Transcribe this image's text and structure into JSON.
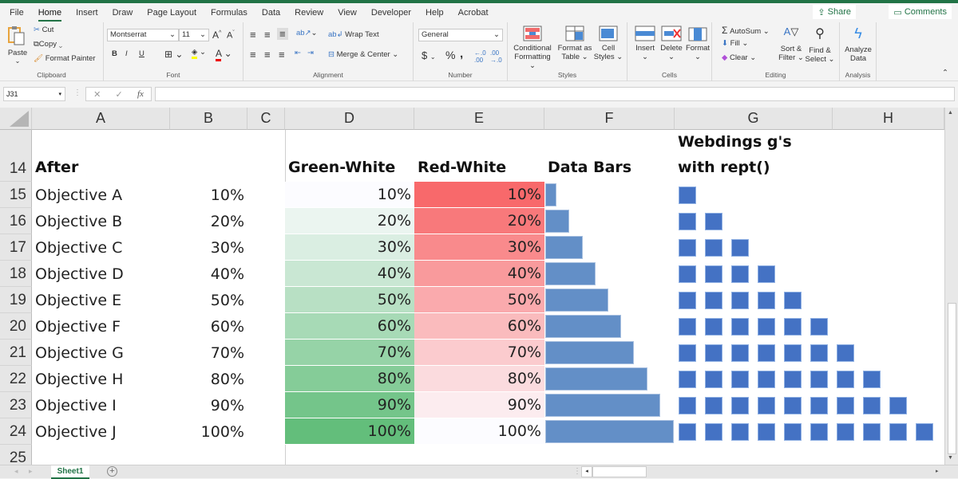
{
  "menu": {
    "items": [
      "File",
      "Home",
      "Insert",
      "Draw",
      "Page Layout",
      "Formulas",
      "Data",
      "Review",
      "View",
      "Developer",
      "Help",
      "Acrobat"
    ],
    "active": "Home",
    "share_label": "Share",
    "comments_label": "Comments"
  },
  "ribbon": {
    "clipboard": {
      "label": "Clipboard",
      "paste": "Paste",
      "cut": "Cut",
      "copy": "Copy",
      "format_painter": "Format Painter"
    },
    "font": {
      "label": "Font",
      "font_name": "Montserrat",
      "font_size": "11",
      "bold": "B",
      "italic": "I",
      "underline": "U"
    },
    "alignment": {
      "label": "Alignment",
      "wrap_text": "Wrap Text",
      "merge_center": "Merge & Center"
    },
    "number": {
      "label": "Number",
      "format": "General",
      "currency": "$",
      "percent": "%",
      "comma": ","
    },
    "styles": {
      "label": "Styles",
      "conditional_formatting": [
        "Conditional",
        "Formatting"
      ],
      "format_as_table": [
        "Format as",
        "Table"
      ],
      "cell_styles": [
        "Cell",
        "Styles"
      ]
    },
    "cells": {
      "label": "Cells",
      "insert": "Insert",
      "delete": "Delete",
      "format": "Format"
    },
    "editing": {
      "label": "Editing",
      "autosum": "AutoSum",
      "fill": "Fill",
      "clear": "Clear",
      "sort_filter": [
        "Sort &",
        "Filter"
      ],
      "find_select": [
        "Find &",
        "Select"
      ]
    },
    "analysis": {
      "label": "Analysis",
      "analyze_data": [
        "Analyze",
        "Data"
      ]
    }
  },
  "formula_bar": {
    "name_box": "J31",
    "formula": ""
  },
  "columns": [
    "A",
    "B",
    "C",
    "D",
    "E",
    "F",
    "G",
    "H"
  ],
  "rows": {
    "header_row": "14",
    "numbers": [
      "15",
      "16",
      "17",
      "18",
      "19",
      "20",
      "21",
      "22",
      "23",
      "24"
    ],
    "last": "25"
  },
  "headers": {
    "A": "After",
    "D": "Green-White",
    "E": "Red-White",
    "F": "Data Bars",
    "G_line1": "Webdings g's",
    "G_line2": "with rept()"
  },
  "objectives": [
    "Objective A",
    "Objective B",
    "Objective C",
    "Objective D",
    "Objective E",
    "Objective F",
    "Objective G",
    "Objective H",
    "Objective I",
    "Objective J"
  ],
  "values_pct": [
    10,
    20,
    30,
    40,
    50,
    60,
    70,
    80,
    90,
    100
  ],
  "values_text": [
    "10%",
    "20%",
    "30%",
    "40%",
    "50%",
    "60%",
    "70%",
    "80%",
    "90%",
    "100%"
  ],
  "colors": {
    "green_max": "#63be7b",
    "green_min": "#fcfcff",
    "red_max": "#f8696b",
    "red_min": "#fcfcff",
    "data_bar": "#638fc7",
    "webdings_square": "#4472c4",
    "accent": "#217346"
  },
  "sheet_tabs": [
    "Sheet1"
  ]
}
